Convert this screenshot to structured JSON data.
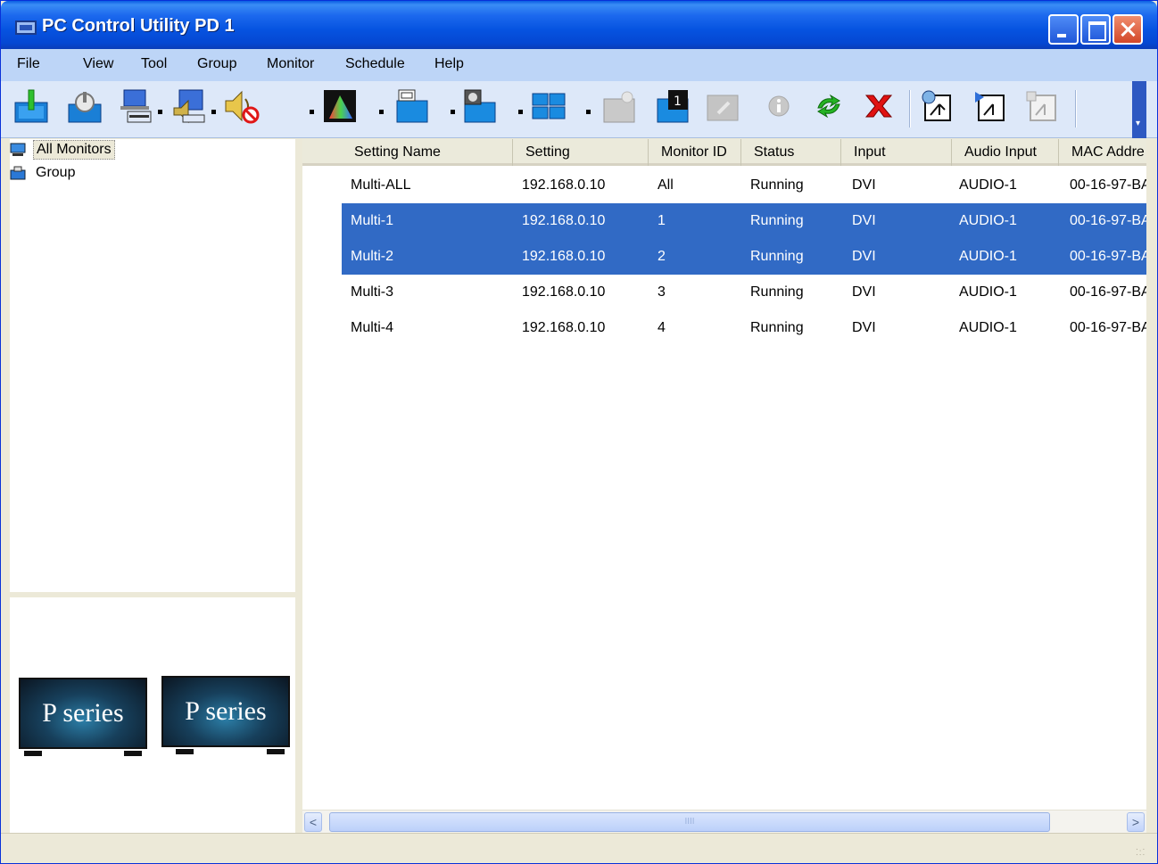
{
  "window": {
    "title": "PC Control Utility PD 1"
  },
  "menu": [
    {
      "label": "File",
      "name": "menu-file"
    },
    {
      "label": "View",
      "name": "menu-view"
    },
    {
      "label": "Tool",
      "name": "menu-tool"
    },
    {
      "label": "Group",
      "name": "menu-group"
    },
    {
      "label": "Monitor",
      "name": "menu-monitor"
    },
    {
      "label": "Schedule",
      "name": "menu-schedule"
    },
    {
      "label": "Help",
      "name": "menu-help"
    }
  ],
  "toolbar": {
    "icons": [
      "power-on-icon",
      "power-off-icon",
      "input-select-icon",
      "audio-input-icon",
      "volume-mute-icon",
      "picture-adjust-icon",
      "aspect-icon",
      "fan-icon",
      "tile-matrix-icon",
      "backlight-icon",
      "monitor-id-icon",
      "refresh-monitor-icon",
      "info-icon",
      "reload-icon",
      "delete-icon",
      "schedule-add-icon",
      "schedule-edit-icon",
      "schedule-delete-icon"
    ]
  },
  "tree": {
    "items": [
      {
        "label": "All Monitors",
        "icon": "monitor-icon",
        "selected": true
      },
      {
        "label": "Group",
        "icon": "group-folder-icon",
        "selected": false
      }
    ]
  },
  "preview": {
    "monitors": [
      "P series",
      "P series"
    ]
  },
  "table": {
    "columns": [
      "Setting Name",
      "Setting",
      "Monitor ID",
      "Status",
      "Input",
      "Audio Input",
      "MAC Addre"
    ],
    "rows": [
      {
        "cells": [
          "Multi-ALL",
          "192.168.0.10",
          "All",
          "Running",
          "DVI",
          "AUDIO-1",
          "00-16-97-BA"
        ],
        "selected": false
      },
      {
        "cells": [
          "Multi-1",
          "192.168.0.10",
          "1",
          "Running",
          "DVI",
          "AUDIO-1",
          "00-16-97-BA"
        ],
        "selected": true
      },
      {
        "cells": [
          "Multi-2",
          "192.168.0.10",
          "2",
          "Running",
          "DVI",
          "AUDIO-1",
          "00-16-97-BA"
        ],
        "selected": true
      },
      {
        "cells": [
          "Multi-3",
          "192.168.0.10",
          "3",
          "Running",
          "DVI",
          "AUDIO-1",
          "00-16-97-BA"
        ],
        "selected": false
      },
      {
        "cells": [
          "Multi-4",
          "192.168.0.10",
          "4",
          "Running",
          "DVI",
          "AUDIO-1",
          "00-16-97-BA"
        ],
        "selected": false
      }
    ]
  },
  "scrollbar": {
    "left_arrow": "<",
    "right_arrow": ">",
    "thumb_grip": "IIII"
  },
  "colors": {
    "selection": "#316ac5",
    "titlebar": "#0653e0",
    "menubar": "#bdd5f7"
  }
}
